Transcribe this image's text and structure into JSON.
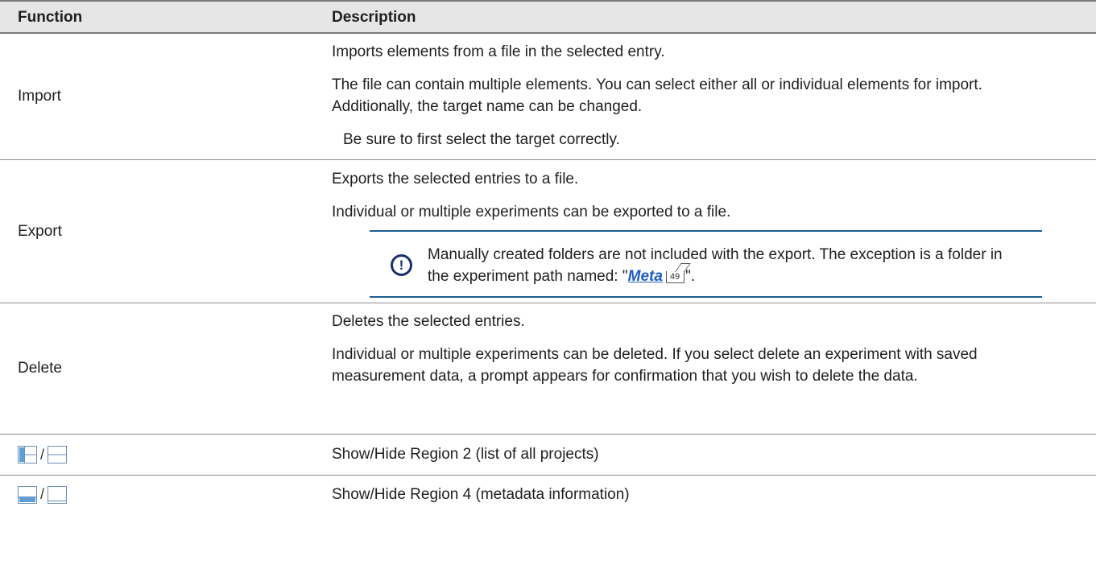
{
  "table": {
    "headers": {
      "function": "Function",
      "description": "Description"
    },
    "import": {
      "function": "Import",
      "line1": "Imports elements from a file in the selected entry.",
      "line2": "The file can contain multiple elements. You can select either all or individual elements for import. Additionally, the target name can be changed.",
      "line3": "Be sure to first select the target correctly."
    },
    "export": {
      "function": "Export",
      "line1": "Exports the selected entries to a file.",
      "line2": "Individual or multiple experiments can be exported to a file.",
      "note_text": "Manually created folders are not included with the export. The exception is a folder in the experiment path named: \"",
      "note_link": "Meta",
      "note_page": "49",
      "note_end": "\".",
      "note_icon": "exclamation-circle-icon",
      "accent_color": "#1f5d94"
    },
    "delete": {
      "function": "Delete",
      "line1": "Deletes the selected entries.",
      "line2": "Individual or multiple experiments can be deleted. If you select delete an experiment with saved measurement data, a prompt appears for confirmation that you wish to delete the data."
    },
    "region2": {
      "separator": "/",
      "icon_show": "show-region2-icon",
      "icon_hide": "hide-region2-icon",
      "description": "Show/Hide Region 2 (list of all projects)"
    },
    "region4": {
      "separator": "/",
      "icon_show": "show-region4-icon",
      "icon_hide": "hide-region4-icon",
      "description": "Show/Hide Region 4 (metadata information)"
    }
  }
}
